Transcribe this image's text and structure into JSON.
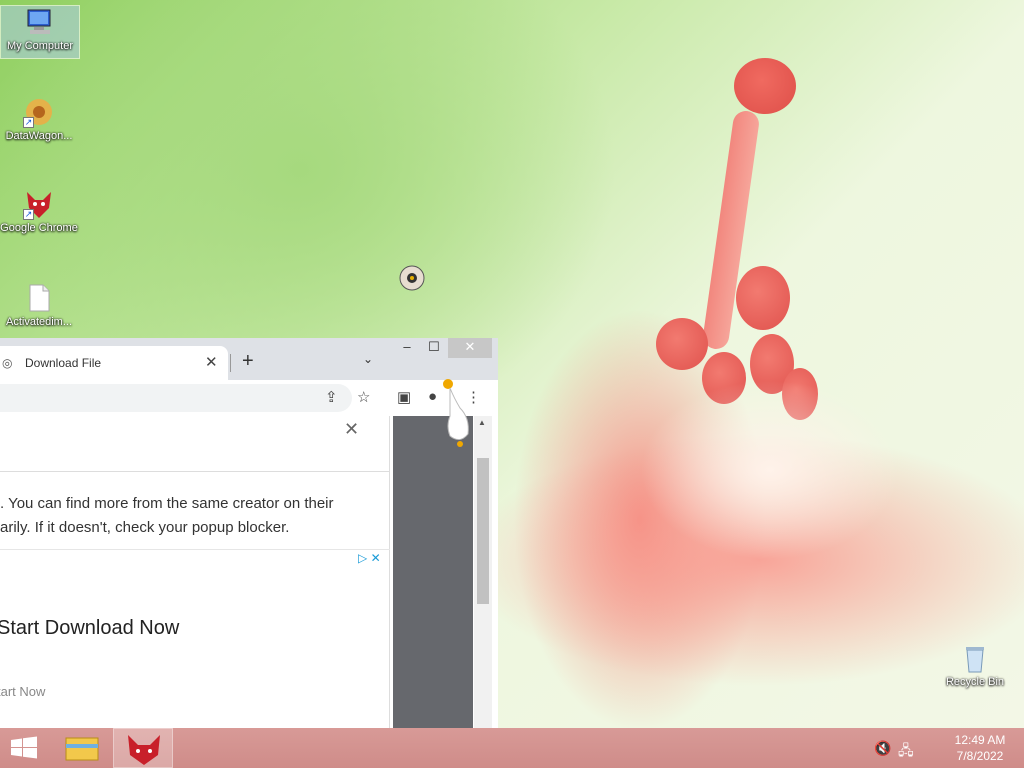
{
  "desktop": {
    "icons": [
      {
        "label": "My Computer"
      },
      {
        "label": "DataWagon..."
      },
      {
        "label": "Google Chrome"
      },
      {
        "label": "Activatedim..."
      },
      {
        "label": "Recycle Bin"
      }
    ]
  },
  "browser": {
    "tab": {
      "title": "Download File"
    },
    "window_controls": {
      "minimize": "–",
      "maximize": "☐",
      "close": "✕"
    },
    "modal": {
      "line1": ". You can find more from the same creator on their",
      "line2": "arily. If it doesn't, check your popup blocker.",
      "ad_title": "Start Download Now",
      "ad_subtitle": "tart Now"
    }
  },
  "taskbar": {
    "time": "12:49 AM",
    "date": "7/8/2022"
  },
  "colors": {
    "taskbar": "#d0908d",
    "chrome_frame": "#dee1e6",
    "adchoice": "#1a9bd7"
  }
}
